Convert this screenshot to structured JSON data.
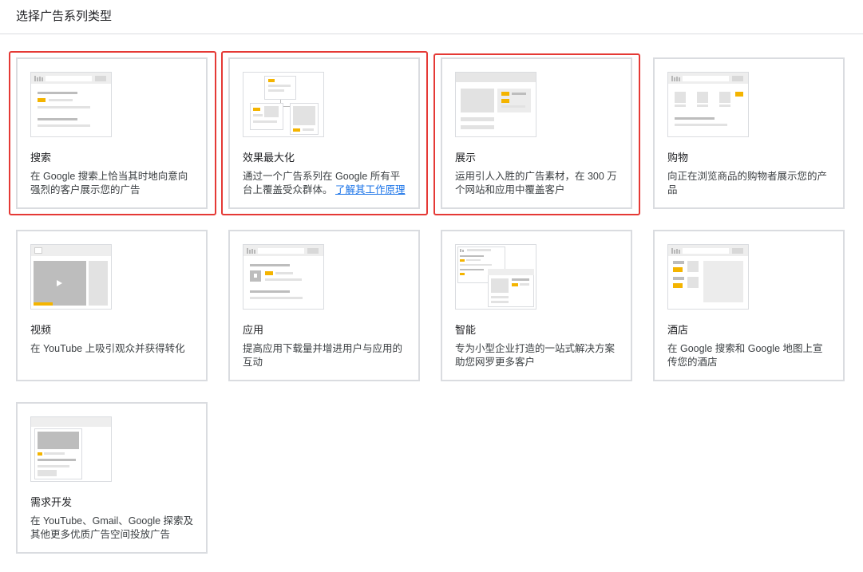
{
  "page": {
    "title": "选择广告系列类型"
  },
  "cards": [
    {
      "key": "search",
      "title": "搜索",
      "desc": "在 Google 搜索上恰当其时地向意向强烈的客户展示您的广告",
      "selected": true
    },
    {
      "key": "pmax",
      "title": "效果最大化",
      "desc": "通过一个广告系列在 Google 所有平台上覆盖受众群体。",
      "link": "了解其工作原理",
      "selected": true
    },
    {
      "key": "display",
      "title": "展示",
      "desc": "运用引人入胜的广告素材，在 300 万个网站和应用中覆盖客户",
      "selected": true
    },
    {
      "key": "shopping",
      "title": "购物",
      "desc": "向正在浏览商品的购物者展示您的产品",
      "selected": false
    },
    {
      "key": "video",
      "title": "视频",
      "desc": "在 YouTube 上吸引观众并获得转化",
      "selected": false
    },
    {
      "key": "app",
      "title": "应用",
      "desc": "提高应用下载量并增进用户与应用的互动",
      "selected": false
    },
    {
      "key": "smart",
      "title": "智能",
      "desc": "专为小型企业打造的一站式解决方案助您网罗更多客户",
      "selected": false
    },
    {
      "key": "hotel",
      "title": "酒店",
      "desc": "在 Google 搜索和 Google 地图上宣传您的酒店",
      "selected": false
    },
    {
      "key": "demandgen",
      "title": "需求开发",
      "desc": "在 YouTube、Gmail、Google 探索及其他更多优质广告空间投放广告",
      "selected": false
    }
  ],
  "colors": {
    "accent": "#f4b400",
    "highlight": "#e53935",
    "link": "#1a73e8",
    "border": "#dadce0"
  }
}
